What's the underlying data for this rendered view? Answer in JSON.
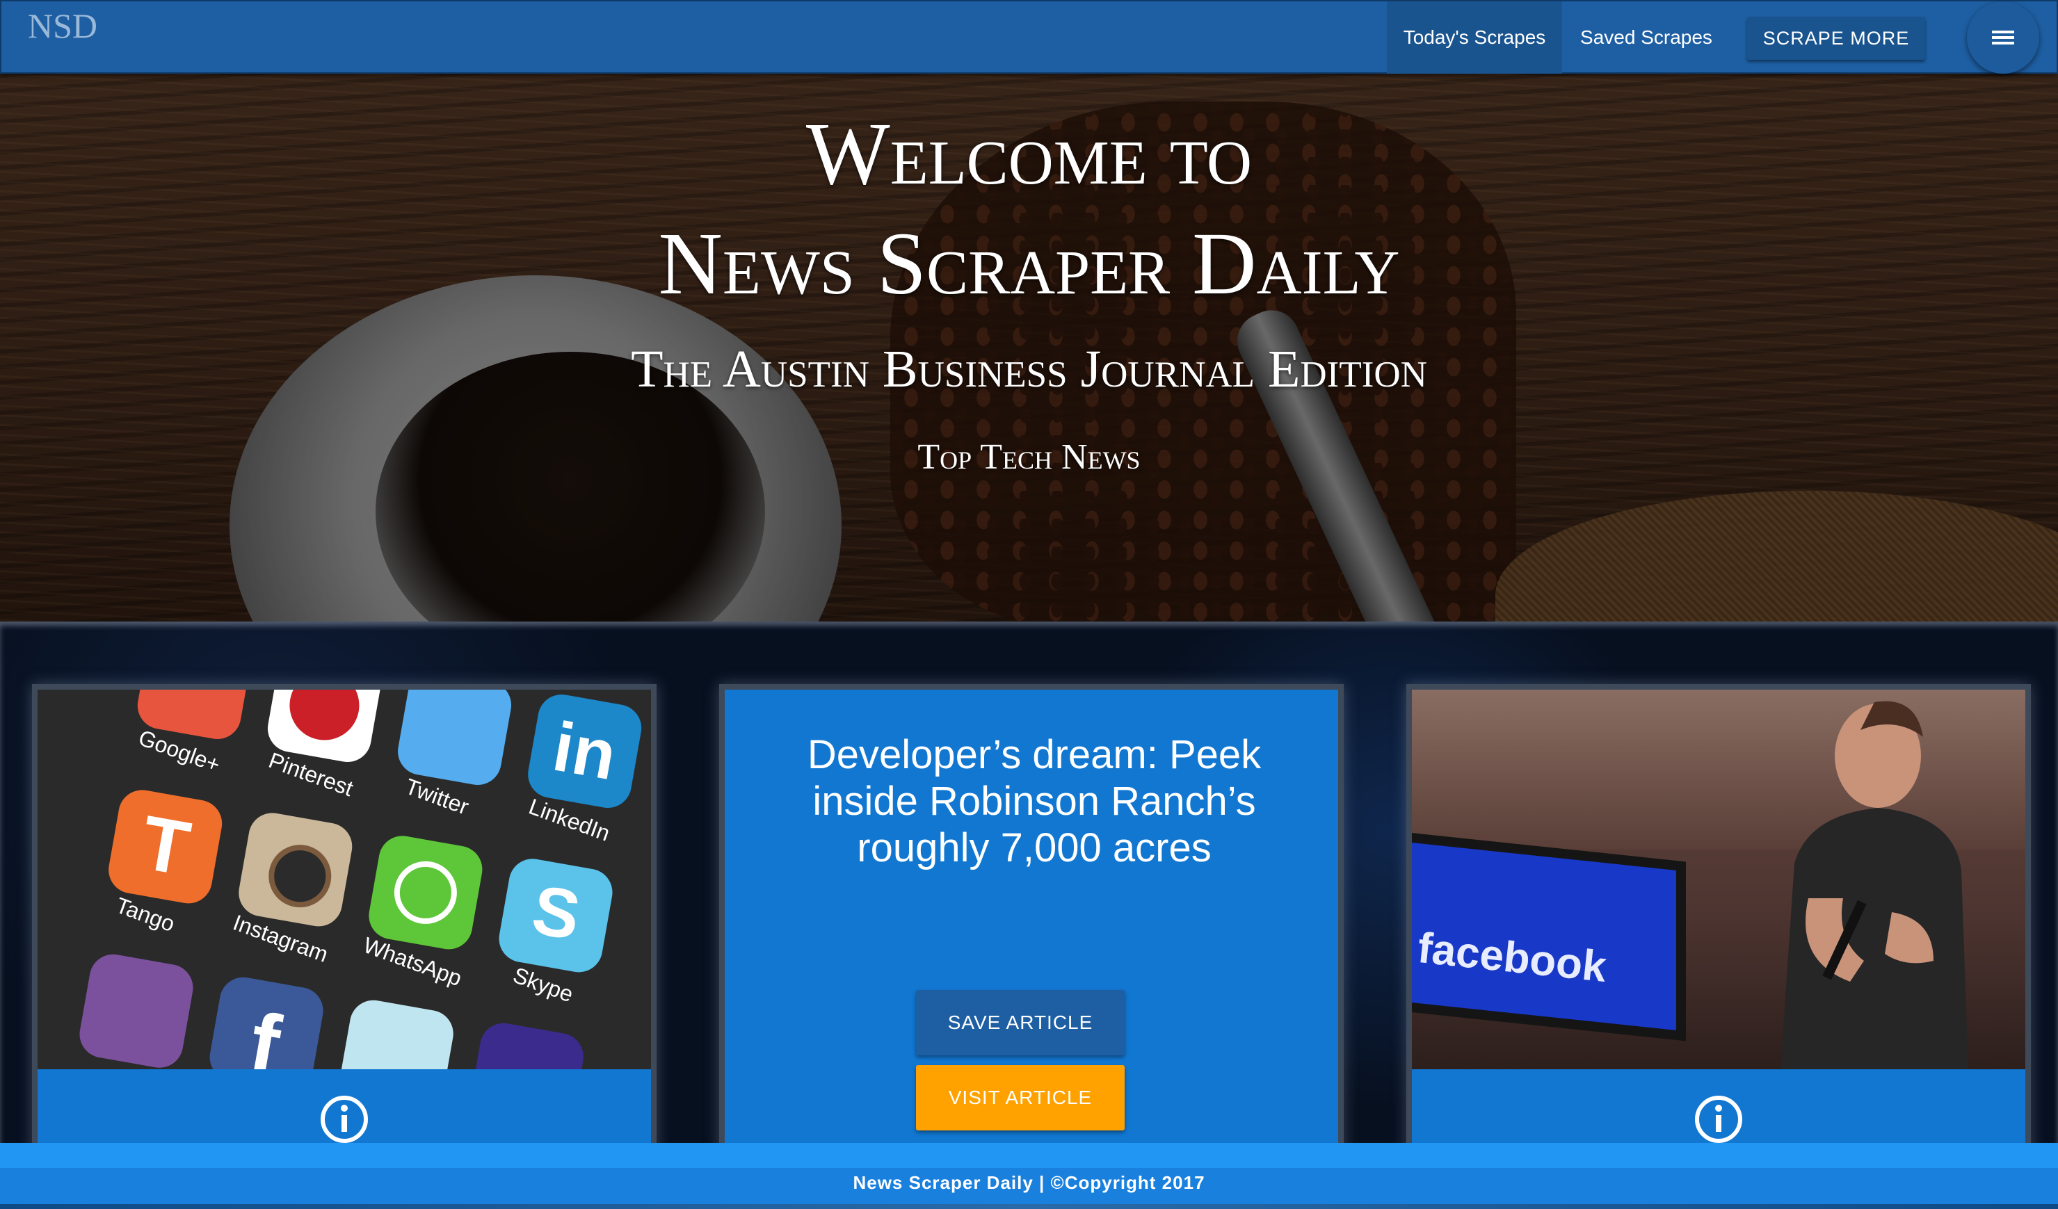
{
  "brand": "NSD",
  "nav": {
    "todays_scrapes": "Today's Scrapes",
    "saved_scrapes": "Saved Scrapes",
    "scrape_more": "SCRAPE MORE",
    "menu_icon": "hamburger-menu-icon"
  },
  "hero": {
    "title_line1": "Welcome to",
    "title_line2": "News Scraper Daily",
    "subtitle": "The Austin Business Journal Edition",
    "tagline": "Top Tech News"
  },
  "cards": [
    {
      "image_labels": [
        "Google+",
        "Pinterest",
        "Twitter",
        "LinkedIn",
        "Tango",
        "Instagram",
        "WhatsApp",
        "Skype"
      ],
      "icon": "info-icon"
    },
    {
      "title": "Developer’s dream: Peek inside Robinson Ranch’s roughly 7,000 acres",
      "save_label": "SAVE ARTICLE",
      "visit_label": "VISIT ARTICLE"
    },
    {
      "image_labels": [
        "facebook"
      ],
      "icon": "info-icon"
    }
  ],
  "footer": {
    "text": "News Scraper Daily | ©Copyright 2017"
  },
  "colors": {
    "nav": "#1e5fa3",
    "card": "#1177d1",
    "visit_button": "#ffa200",
    "footer": "#2196f3"
  }
}
